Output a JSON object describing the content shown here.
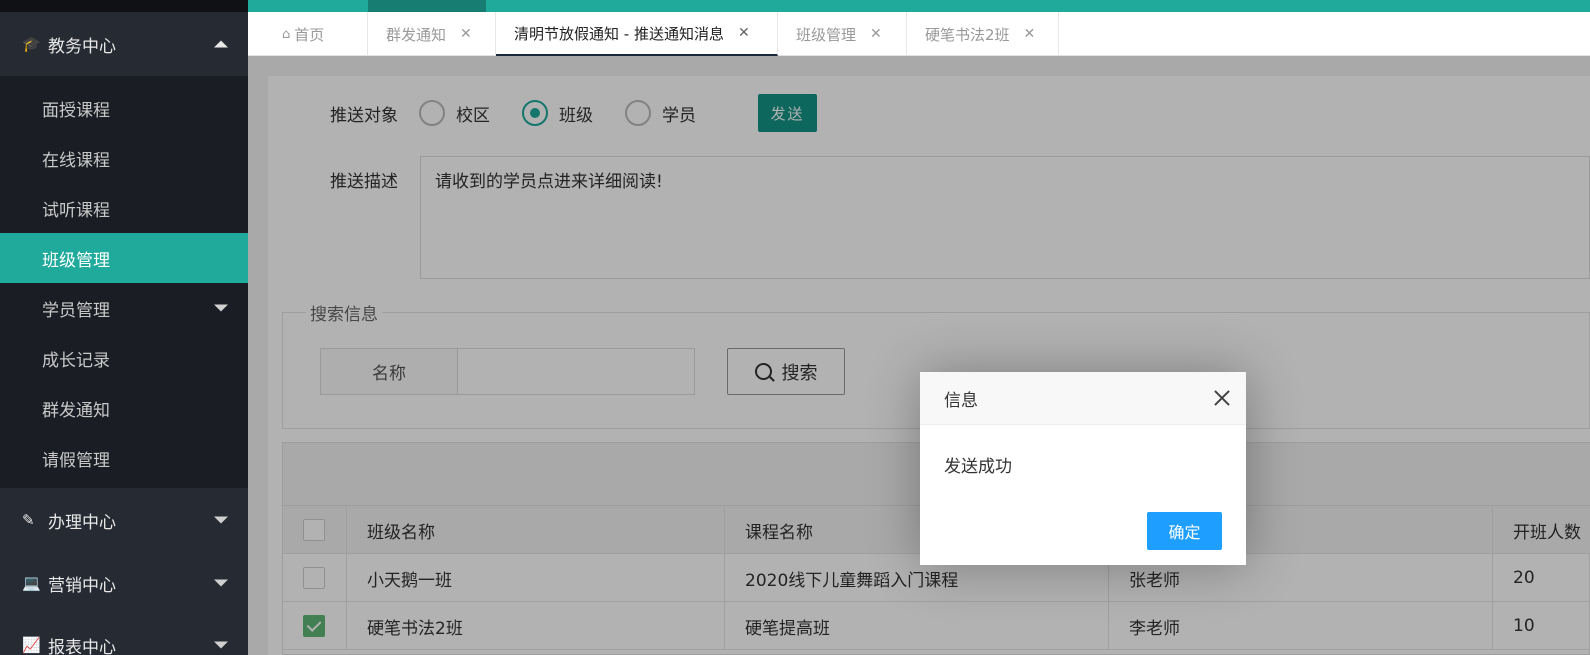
{
  "sidebar": {
    "groups": [
      {
        "label": "教务中心",
        "icon": "graduation-cap-icon",
        "expanded": true
      },
      {
        "label": "办理中心",
        "icon": "edit-icon",
        "expanded": false
      },
      {
        "label": "营销中心",
        "icon": "laptop-icon",
        "expanded": false
      },
      {
        "label": "报表中心",
        "icon": "line-chart-icon",
        "expanded": false
      }
    ],
    "items": [
      {
        "label": "面授课程"
      },
      {
        "label": "在线课程"
      },
      {
        "label": "试听课程"
      },
      {
        "label": "班级管理",
        "active": true
      },
      {
        "label": "学员管理",
        "has_submenu": true
      },
      {
        "label": "成长记录"
      },
      {
        "label": "群发通知"
      },
      {
        "label": "请假管理"
      }
    ]
  },
  "tabs": [
    {
      "label": "首页",
      "icon": "home-icon"
    },
    {
      "label": "群发通知"
    },
    {
      "label": "清明节放假通知 - 推送通知消息",
      "active": true
    },
    {
      "label": "班级管理"
    },
    {
      "label": "硬笔书法2班"
    }
  ],
  "form": {
    "target_label": "推送对象",
    "radios": [
      {
        "label": "校区",
        "checked": false
      },
      {
        "label": "班级",
        "checked": true
      },
      {
        "label": "学员",
        "checked": false
      }
    ],
    "send_label": "发送",
    "desc_label": "推送描述",
    "desc_value": "请收到的学员点进来详细阅读!"
  },
  "search": {
    "legend": "搜索信息",
    "name_label": "名称",
    "name_value": "",
    "button_label": "搜索"
  },
  "table": {
    "headers": [
      "班级名称",
      "课程名称",
      "",
      "开班人数"
    ],
    "rows": [
      {
        "checked": false,
        "cells": [
          "小天鹅一班",
          "2020线下儿童舞蹈入门课程",
          "张老师",
          "20"
        ]
      },
      {
        "checked": true,
        "cells": [
          "硬笔书法2班",
          "硬笔提高班",
          "李老师",
          "10"
        ]
      }
    ]
  },
  "dialog": {
    "title": "信息",
    "message": "发送成功",
    "ok_label": "确定"
  },
  "colors": {
    "accent": "#1faa9b",
    "sidebar_bg": "#1a1e24",
    "primary_button": "#1e9fff"
  }
}
